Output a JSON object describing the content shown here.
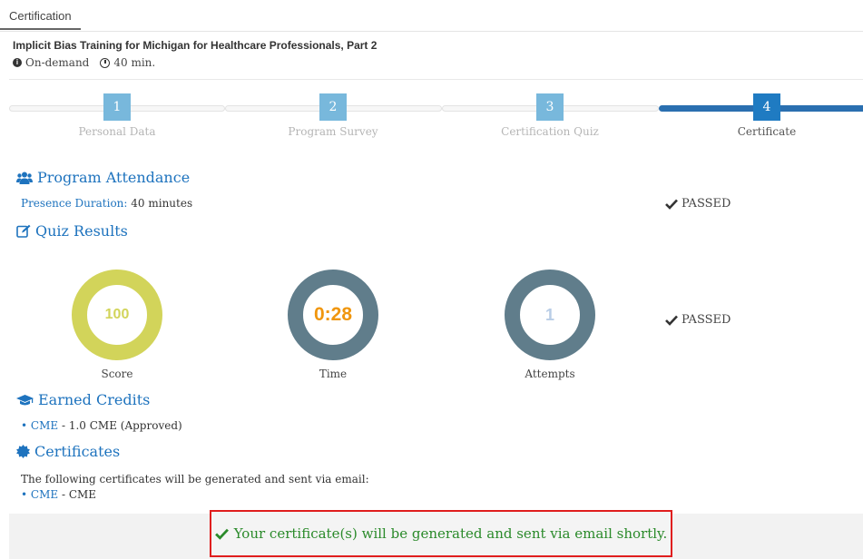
{
  "tab": {
    "label": "Certification"
  },
  "course": {
    "title": "Implicit Bias Training for Michigan for Healthcare Professionals, Part 2",
    "mode": "On-demand",
    "duration": "40 min."
  },
  "steps": [
    {
      "number": "1",
      "label": "Personal Data"
    },
    {
      "number": "2",
      "label": "Program Survey"
    },
    {
      "number": "3",
      "label": "Certification Quiz"
    },
    {
      "number": "4",
      "label": "Certificate"
    }
  ],
  "attendance": {
    "heading": "Program Attendance",
    "duration_label": "Presence Duration:",
    "duration_value": "40 minutes",
    "status": "PASSED"
  },
  "quiz": {
    "heading": "Quiz Results",
    "score": {
      "value": "100",
      "label": "Score",
      "color": "#d2d45a"
    },
    "time": {
      "value": "0:28",
      "label": "Time",
      "color": "#607d8b"
    },
    "attempts": {
      "value": "1",
      "label": "Attempts",
      "color": "#607d8b"
    },
    "status": "PASSED"
  },
  "credits": {
    "heading": "Earned Credits",
    "bullet": "•",
    "type": "CME",
    "detail": "- 1.0 CME (Approved)"
  },
  "certificates": {
    "heading": "Certificates",
    "intro": "The following certificates will be generated and sent via email:",
    "bullet": "•",
    "type": "CME",
    "detail": "- CME"
  },
  "notice": {
    "text": "Your certificate(s) will be generated and sent via email shortly."
  },
  "colors": {
    "accent": "#1e73be",
    "success": "#2a8a2a",
    "highlight": "#e01e1e"
  }
}
